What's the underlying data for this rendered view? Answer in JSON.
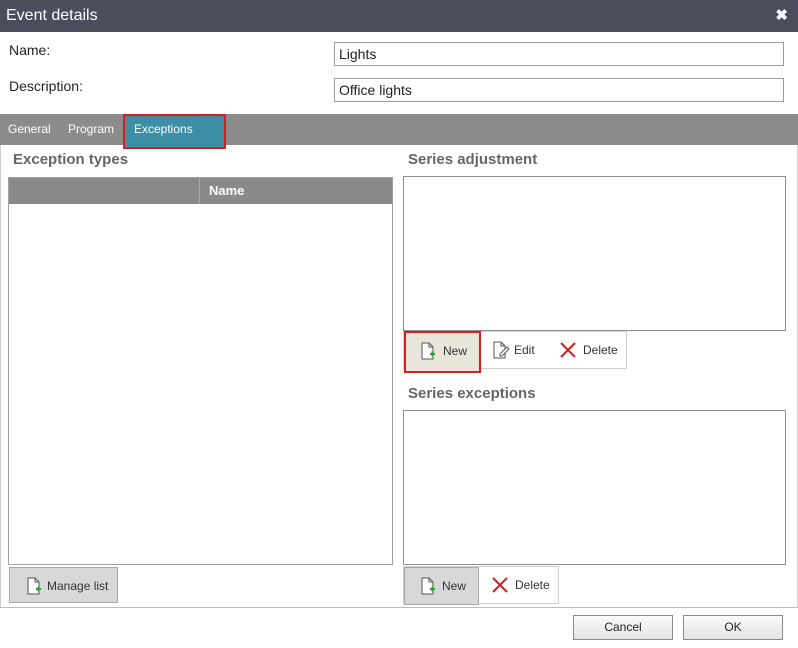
{
  "dialog": {
    "title": "Event details",
    "close_icon": "close-icon"
  },
  "form": {
    "name_label": "Name:",
    "name_value": "Lights",
    "description_label": "Description:",
    "description_value": "Office lights"
  },
  "tabs": [
    "General",
    "Program",
    "Exceptions"
  ],
  "active_tab": "Exceptions",
  "exception_types": {
    "title": "Exception types",
    "columns": [
      "",
      "Name"
    ],
    "rows": [],
    "manage_label": "Manage list"
  },
  "series_adjustment": {
    "title": "Series adjustment",
    "new_label": "New",
    "edit_label": "Edit",
    "delete_label": "Delete"
  },
  "series_exceptions": {
    "title": "Series exceptions",
    "new_label": "New",
    "delete_label": "Delete"
  },
  "footer": {
    "cancel_label": "Cancel",
    "ok_label": "OK"
  },
  "colors": {
    "titlebar": "#4a4d5c",
    "tab_active": "#3d8fa6",
    "highlight": "#d81f1f",
    "delete_icon": "#cc2222",
    "add_icon": "#2e9e2e"
  }
}
